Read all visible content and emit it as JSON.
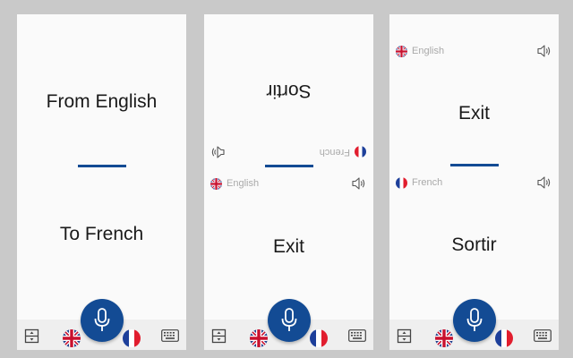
{
  "panels": [
    {
      "top_text": "From English",
      "bottom_text": "To French"
    },
    {
      "top_text": "Sortir",
      "top_lang_name": "French",
      "bottom_lang_name": "English",
      "bottom_text": "Exit"
    },
    {
      "top_lang_name": "English",
      "top_text": "Exit",
      "bottom_lang_name": "French",
      "bottom_text": "Sortir"
    }
  ],
  "icons": {
    "speaker": "speaker-icon",
    "mic": "microphone-icon",
    "swap": "swap-layout-icon",
    "keyboard": "keyboard-icon",
    "flag_en": "uk-flag-icon",
    "flag_fr": "france-flag-icon"
  },
  "colors": {
    "accent": "#134b94",
    "background": "#c9c9c9",
    "panel": "#fafafa",
    "bar": "#efefef",
    "muted_text": "#a9a9a9"
  }
}
